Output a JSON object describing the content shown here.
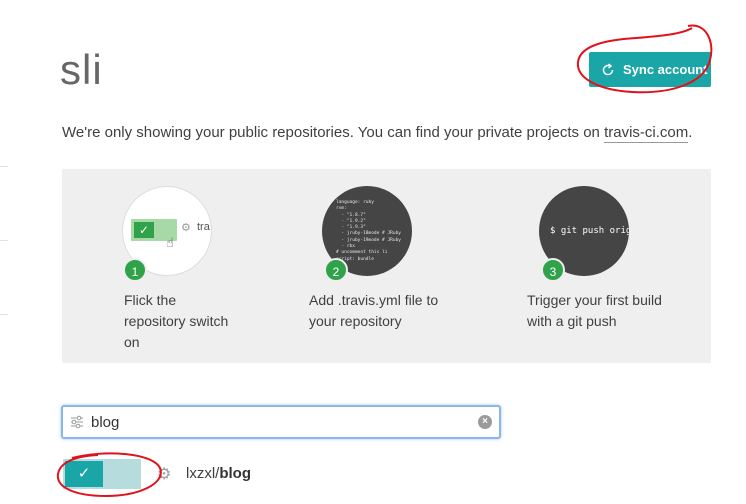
{
  "header": {
    "title": "sli",
    "sync_button_label": "Sync account"
  },
  "notice": {
    "text": "We're only showing your public repositories. You can find your private projects on ",
    "link_text": "travis-ci.com",
    "suffix": "."
  },
  "onboarding": {
    "steps": [
      {
        "number": "1",
        "line1": "Flick the",
        "line2": "repository switch",
        "line3": "on"
      },
      {
        "number": "2",
        "line1": "Add .travis.yml file to",
        "line2": "your repository"
      },
      {
        "number": "3",
        "line1": "Trigger your first build",
        "line2": "with a git push"
      }
    ],
    "illustration_1_text": "tra",
    "illustration_2_code": "language: ruby\nrvm:\n  - \"1.8.7\"\n  - \"1.9.2\"\n  - \"1.9.3\"\n  - jruby-18mode # JRuby\n  - jruby-19mode # JRuby\n  - rbx\n# uncomment this li\nscript: bundle",
    "illustration_3_text": "$ git push origin"
  },
  "search": {
    "value": "blog",
    "placeholder": ""
  },
  "repos": [
    {
      "owner": "lxzxl/",
      "name": "blog",
      "enabled": true
    }
  ],
  "colors": {
    "accent": "#1aa5a7",
    "success": "#2fa24a",
    "annotation": "#e0121b"
  },
  "icons": {
    "sync": "sync-icon",
    "filter": "filter-icon",
    "clear": "clear-icon",
    "gear": "gear-icon",
    "check": "check-icon"
  }
}
